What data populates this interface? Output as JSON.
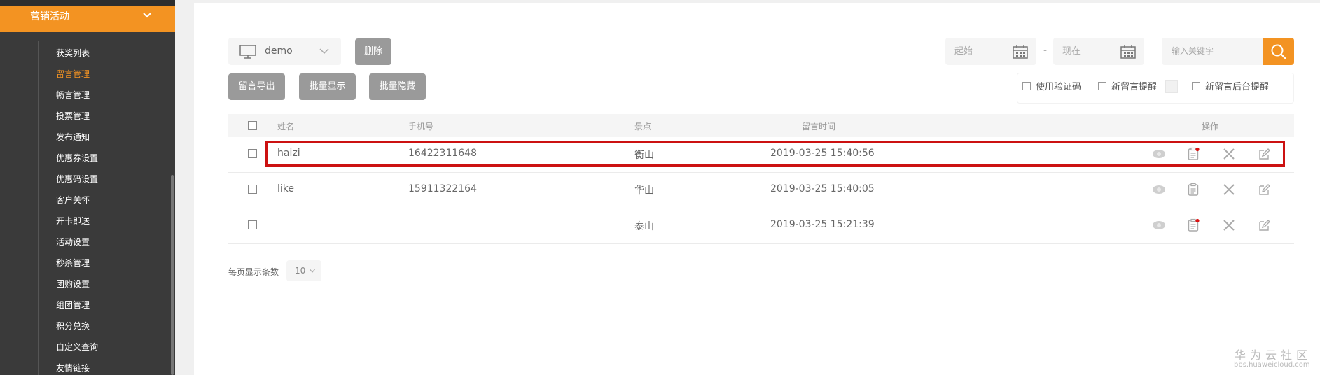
{
  "sidebar": {
    "section_label": "营销活动",
    "items": [
      {
        "label": "获奖列表",
        "active": false
      },
      {
        "label": "留言管理",
        "active": true
      },
      {
        "label": "畅言管理",
        "active": false
      },
      {
        "label": "投票管理",
        "active": false
      },
      {
        "label": "发布通知",
        "active": false
      },
      {
        "label": "优惠券设置",
        "active": false
      },
      {
        "label": "优惠码设置",
        "active": false
      },
      {
        "label": "客户关怀",
        "active": false
      },
      {
        "label": "开卡即送",
        "active": false
      },
      {
        "label": "活动设置",
        "active": false
      },
      {
        "label": "秒杀管理",
        "active": false
      },
      {
        "label": "团购设置",
        "active": false
      },
      {
        "label": "组团管理",
        "active": false
      },
      {
        "label": "积分兑换",
        "active": false
      },
      {
        "label": "自定义查询",
        "active": false
      },
      {
        "label": "友情链接",
        "active": false
      }
    ]
  },
  "toolbar": {
    "site_select": "demo",
    "delete_label": "删除",
    "export_label": "留言导出",
    "batch_show_label": "批量显示",
    "batch_hide_label": "批量隐藏",
    "start_placeholder": "起始",
    "end_placeholder": "现在",
    "date_separator": "-",
    "search_placeholder": "输入关键字"
  },
  "options": {
    "use_captcha": "使用验证码",
    "new_message_alert": "新留言提醒",
    "new_message_backend_alert": "新留言后台提醒"
  },
  "table": {
    "headers": {
      "name": "姓名",
      "phone": "手机号",
      "spot": "景点",
      "time": "留言时间",
      "actions": "操作"
    },
    "rows": [
      {
        "name": "haizi",
        "phone": "16422311648",
        "spot": "衡山",
        "time": "2019-03-25 15:40:56",
        "has_reply_dot": true
      },
      {
        "name": "like",
        "phone": "15911322164",
        "spot": "华山",
        "time": "2019-03-25 15:40:05",
        "has_reply_dot": false
      },
      {
        "name": "",
        "phone": "",
        "spot": "泰山",
        "time": "2019-03-25 15:21:39",
        "has_reply_dot": true
      }
    ]
  },
  "pager": {
    "label": "每页显示条数",
    "page_size": "10"
  },
  "watermark": {
    "line1": "华为云社区",
    "line2": "bbs.huaweicloud.com"
  },
  "colors": {
    "accent": "#f39322",
    "sidebar_bg": "#3a3a3a",
    "highlight_border": "#cc1111",
    "button_gray": "#9a9a9a"
  },
  "icons": [
    "chevron-down-icon",
    "monitor-icon",
    "calendar-icon",
    "search-icon",
    "eye-icon",
    "clipboard-icon",
    "close-icon",
    "edit-icon"
  ]
}
